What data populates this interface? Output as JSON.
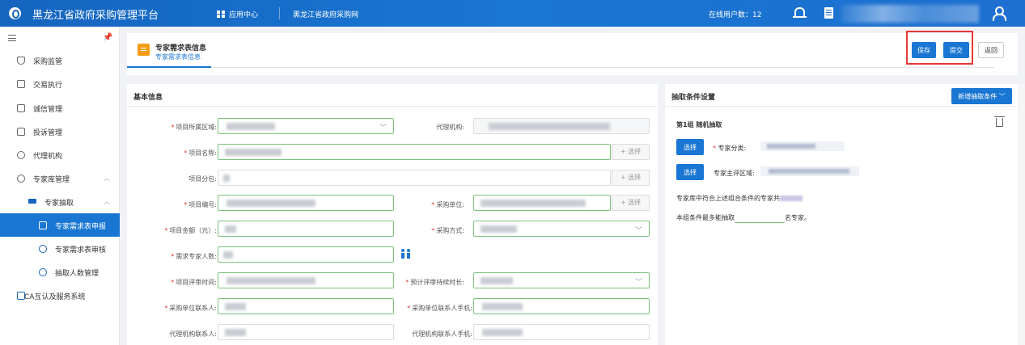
{
  "topbar": {
    "title": "黑龙江省政府采购管理平台",
    "app_center": "应用中心",
    "link": "黑龙江省政府采购网",
    "online_users": "在线用户数：12"
  },
  "sidebar": {
    "items": [
      {
        "label": "采购监管"
      },
      {
        "label": "交易执行"
      },
      {
        "label": "诚信管理"
      },
      {
        "label": "投诉管理"
      },
      {
        "label": "代理机构"
      },
      {
        "label": "专家库管理"
      },
      {
        "label": "专家抽取"
      },
      {
        "label": "专家需求表申报"
      },
      {
        "label": "专家需求表审核"
      },
      {
        "label": "抽取人数管理"
      },
      {
        "label": "CA互认及服务系统"
      }
    ]
  },
  "header": {
    "title": "专家需求表信息",
    "tab": "专家需求表信息",
    "save_label": "保存",
    "submit_label": "提交",
    "back_label": "返回"
  },
  "basic": {
    "title": "基本信息",
    "select_label": "+ 选择",
    "labels": {
      "region": "项目所属区域:",
      "agency": "代理机构:",
      "name": "项目名称:",
      "package": "项目分包:",
      "number": "项目编号:",
      "purchaser": "采购单位:",
      "amount": "项目金额（元）:",
      "method": "采购方式:",
      "experts": "需求专家人数:",
      "review_time": "项目评审时间:",
      "duration": "预计评审持续时长:",
      "contact": "采购单位联系人:",
      "contact_phone": "采购单位联系人手机:",
      "agency_contact": "代理机构联系人:",
      "agency_phone": "代理机构联系人手机:"
    }
  },
  "conditions": {
    "title": "抽取条件设置",
    "add_label": "新增抽取条件",
    "group_title": "第1组  随机抽取",
    "choose_label": "选择",
    "category_label": "专家分类:",
    "area_label": "专家主评区域:",
    "info_line1": "专家库中符合上述组合条件的专家共",
    "info_line2": "本组条件最多能抽取",
    "info_line2_suffix": "名专家。"
  }
}
